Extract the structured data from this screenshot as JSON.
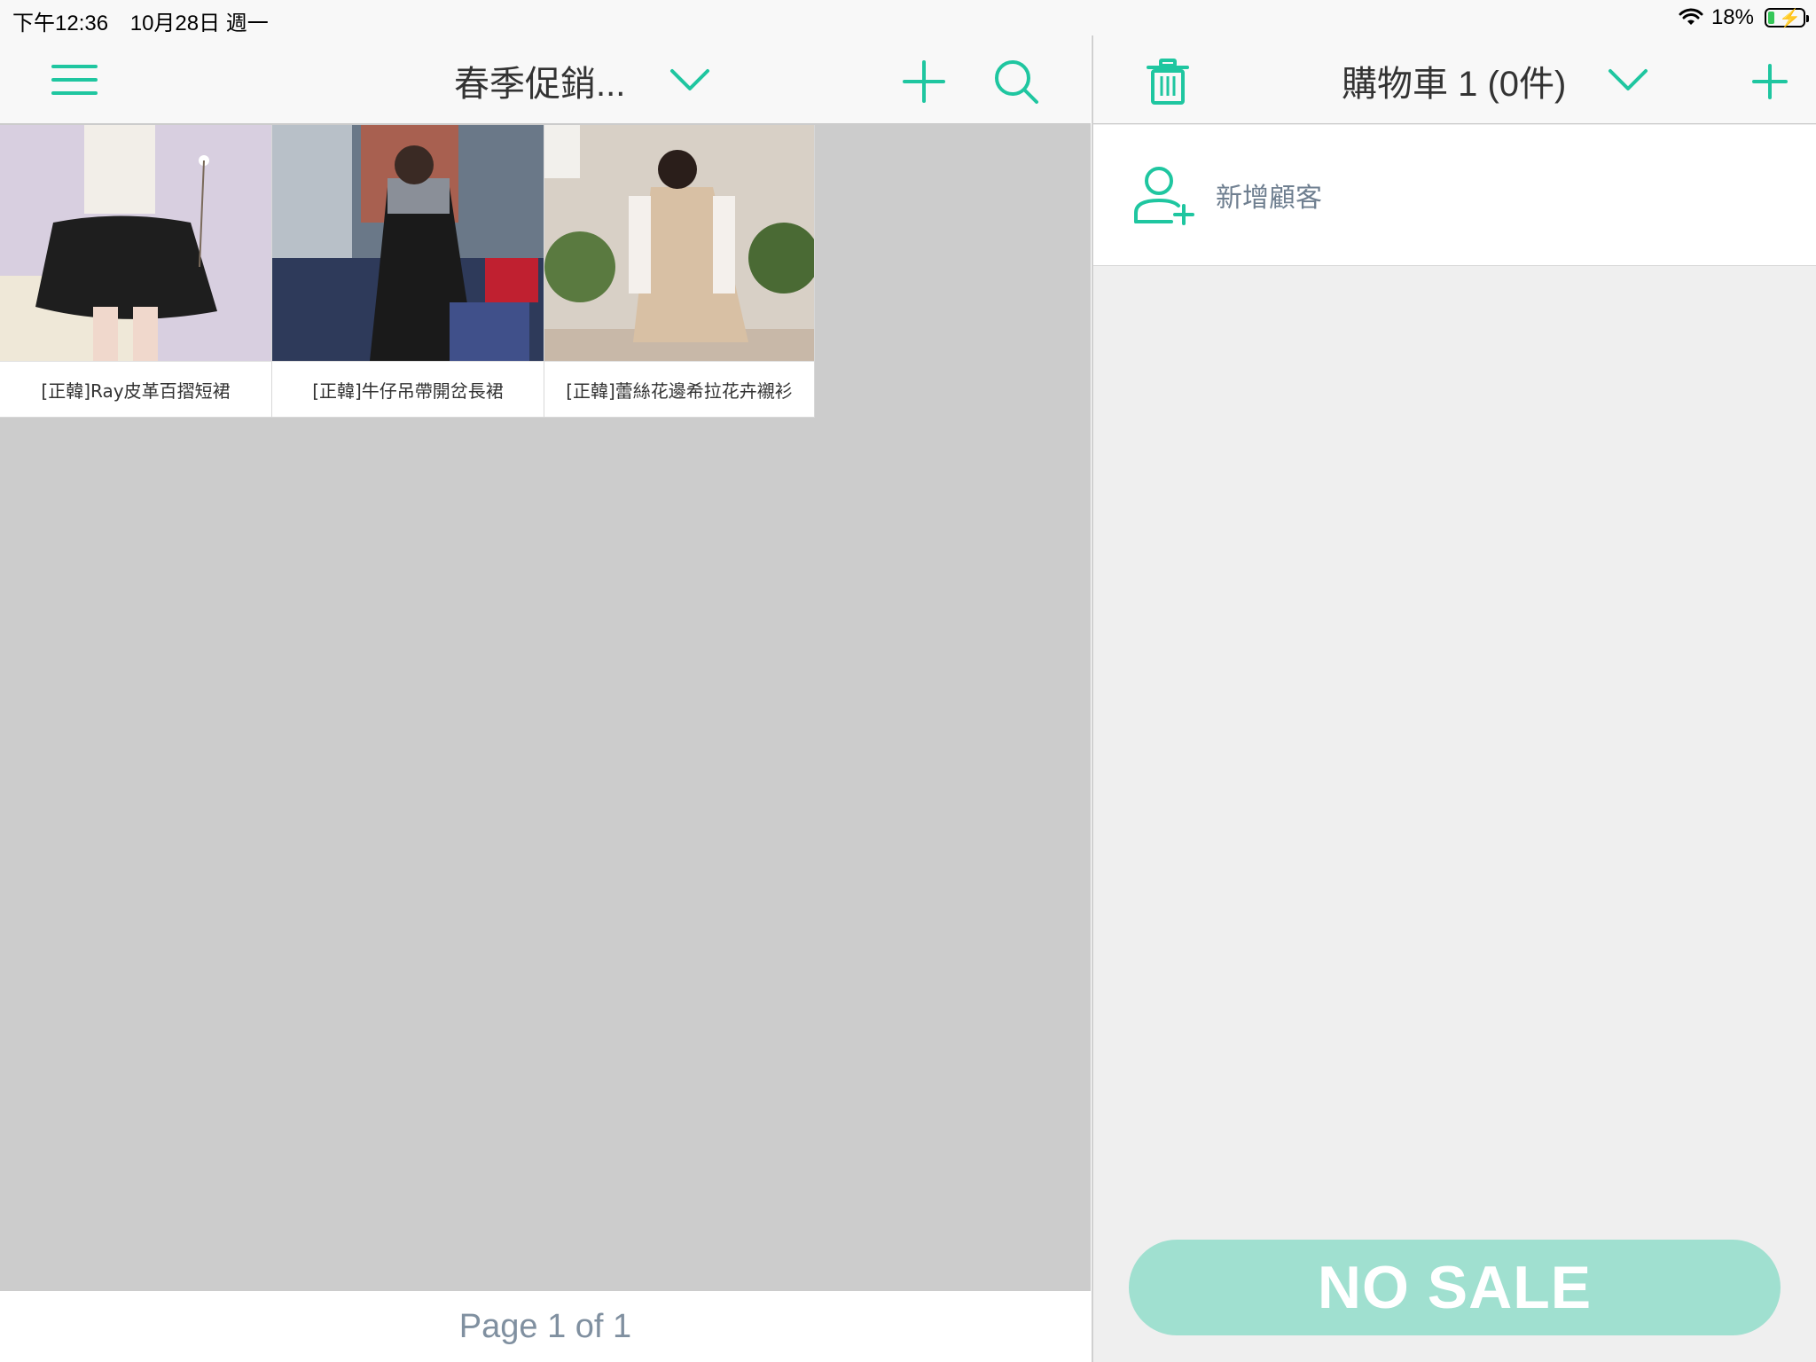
{
  "status_bar": {
    "time": "下午12:36",
    "date": "10月28日 週一",
    "battery_percent": "18%",
    "battery_level": 0.18
  },
  "left_header": {
    "title": "春季促銷...",
    "icons": [
      "menu-icon",
      "chevron-down-icon",
      "plus-icon",
      "search-icon"
    ]
  },
  "products": [
    {
      "name": "[正韓]Ray皮革百摺短裙"
    },
    {
      "name": "[正韓]牛仔吊帶開岔長裙"
    },
    {
      "name": "[正韓]蕾絲花邊希拉花卉襯衫"
    }
  ],
  "footer": {
    "page_label": "Page 1 of 1"
  },
  "right_header": {
    "title": "購物車 1 (0件)",
    "icons": [
      "trash-icon",
      "chevron-down-icon",
      "plus-icon"
    ]
  },
  "customer": {
    "add_label": "新增顧客"
  },
  "no_sale_label": "NO SALE",
  "colors": {
    "accent": "#1fc6a0",
    "no_sale_bg": "#a0e0d0",
    "grid_bg": "#cccccc",
    "panel_bg": "#efefef"
  }
}
